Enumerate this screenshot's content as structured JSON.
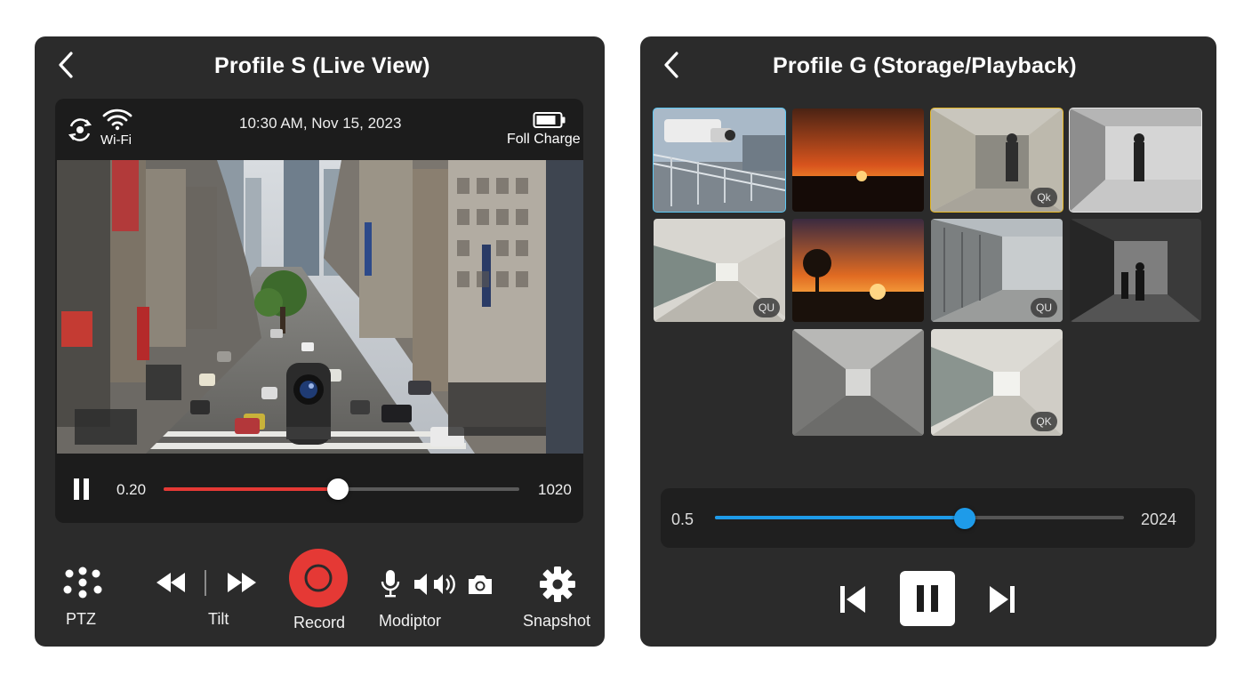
{
  "live": {
    "title": "Profile S (Live View)",
    "status": {
      "wifi_label": "Wi-Fi",
      "datetime": "10:30 AM, Nov 15, 2023",
      "battery_label": "Foll Charge"
    },
    "playback": {
      "current_time": "0.20",
      "total_time": "1020",
      "progress": 0.49
    },
    "controls": [
      {
        "label": "PTZ",
        "icon": "dots-grid-icon"
      },
      {
        "label": "Tilt",
        "icon": "rewind-fastforward-icon"
      },
      {
        "label": "Record",
        "icon": "record-icon"
      },
      {
        "label": "Modiptor",
        "icon": "mic-speaker-camera-icon"
      },
      {
        "label": "Snapshot",
        "icon": "gear-icon"
      }
    ]
  },
  "playback": {
    "title": "Profile G (Storage/Playback)",
    "thumbnails": [
      {
        "scene": "rooftop-camera",
        "badge": ""
      },
      {
        "scene": "sunset",
        "badge": ""
      },
      {
        "scene": "corridor-person",
        "badge": "Qk"
      },
      {
        "scene": "corridor-person-bw",
        "badge": ""
      },
      {
        "scene": "office-hallway",
        "badge": "QU"
      },
      {
        "scene": "tree-sunset",
        "badge": ""
      },
      {
        "scene": "building-walkway",
        "badge": "QU"
      },
      {
        "scene": "dark-corridor-people",
        "badge": ""
      },
      {
        "scene": "long-corridor",
        "badge": ""
      },
      {
        "scene": "bright-hallway",
        "badge": "QK"
      }
    ],
    "timeline": {
      "start_label": "0.5",
      "end_label": "2024",
      "progress": 0.61
    }
  },
  "colors": {
    "panel_bg": "#2b2b2b",
    "record_red": "#e53935",
    "seek_red": "#e53935",
    "timeline_blue": "#1e9be9",
    "selected_border": "#5bc8f5",
    "highlight_border": "#e8b923"
  }
}
